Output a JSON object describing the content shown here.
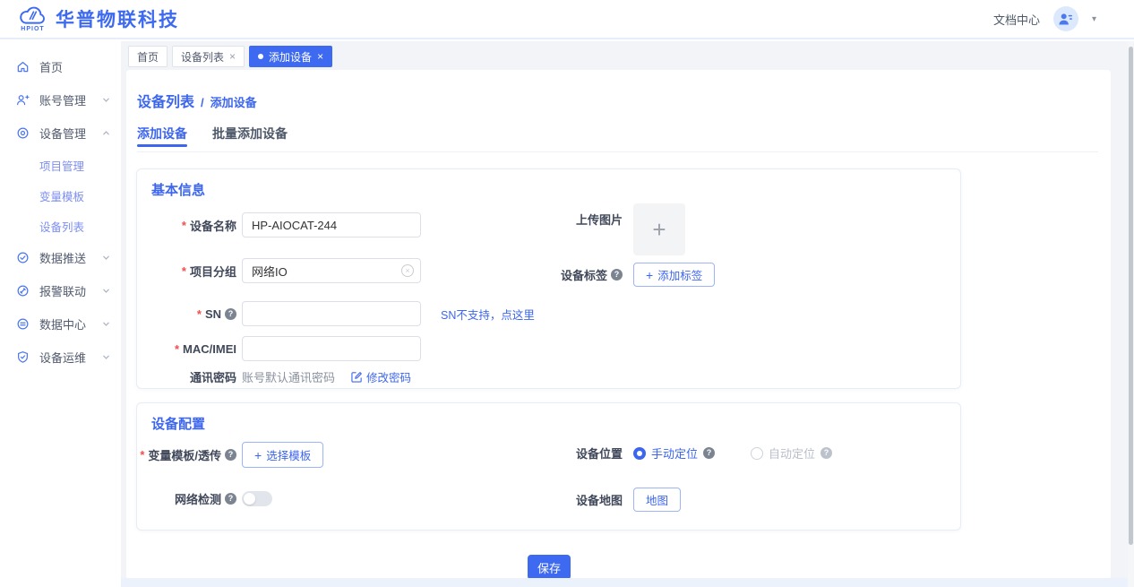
{
  "header": {
    "brand_small": "HPIOT",
    "brand_name": "华普物联科技",
    "doc_center": "文档中心"
  },
  "tabstrip": {
    "tab_home": "首页",
    "tab_device_list": "设备列表",
    "tab_add_device": "添加设备",
    "close_glyph": "×"
  },
  "sidebar": {
    "home": "首页",
    "account": "账号管理",
    "device_mgmt": "设备管理",
    "sub_project": "项目管理",
    "sub_template": "变量模板",
    "sub_device_list": "设备列表",
    "data_push": "数据推送",
    "alarm": "报警联动",
    "data_center": "数据中心",
    "device_ops": "设备运维"
  },
  "page": {
    "breadcrumb_parent": "设备列表",
    "breadcrumb_sep": "/",
    "breadcrumb_current": "添加设备",
    "tab_add": "添加设备",
    "tab_batch_add": "批量添加设备"
  },
  "basic": {
    "title": "基本信息",
    "device_name_label": "设备名称",
    "device_name_value": "HP-AIOCAT-244",
    "project_group_label": "项目分组",
    "project_group_value": "网络IO",
    "sn_label": "SN",
    "sn_hint": "SN不支持，点这里",
    "mac_label": "MAC/IMEI",
    "comm_pwd_label": "通讯密码",
    "comm_pwd_value": "账号默认通讯密码",
    "comm_pwd_action": "修改密码",
    "upload_label": "上传图片",
    "tag_label": "设备标签",
    "tag_button": "添加标签"
  },
  "config": {
    "title": "设备配置",
    "template_label": "变量模板/透传",
    "template_button": "选择模板",
    "network_label": "网络检测",
    "location_label": "设备位置",
    "location_manual": "手动定位",
    "location_auto": "自动定位",
    "map_label": "设备地图",
    "map_button": "地图"
  },
  "footer": {
    "save": "保存"
  },
  "glyphs": {
    "required": "*",
    "plus": "+",
    "help": "?",
    "caret": "▾",
    "close": "×"
  },
  "colors": {
    "primary": "#3D6AF0",
    "submenu_blue": "#7E8FF0",
    "required_red": "#F34D4D",
    "label_text": "#40485A",
    "muted_text": "#8A919F",
    "input_border": "#DCDFE6",
    "panel_border": "#E8ECF3",
    "main_bg": "#F2F4F7",
    "toggle_off": "#E2E5EB",
    "bottom_strip": "#ECF2FC"
  }
}
